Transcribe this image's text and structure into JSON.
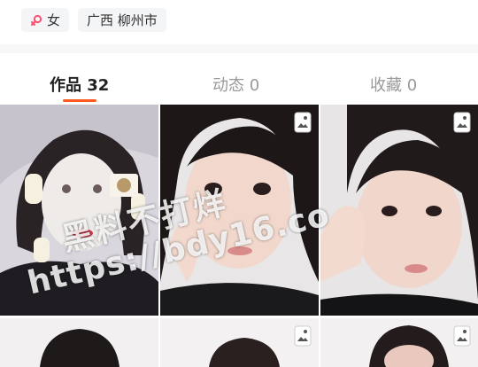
{
  "profile": {
    "gender_label": "女",
    "location_label": "广西 柳州市"
  },
  "tabs": [
    {
      "label": "作品 32",
      "active": true
    },
    {
      "label": "动态 0",
      "active": false
    },
    {
      "label": "收藏 0",
      "active": false
    }
  ],
  "accent_color": "#ff5a1f",
  "grid": {
    "items": [
      {
        "icon": "photo"
      },
      {
        "icon": "album-icon"
      },
      {
        "icon": "album-icon"
      },
      {
        "icon": "photo"
      },
      {
        "icon": "album-icon"
      },
      {
        "icon": "album-icon"
      }
    ]
  },
  "watermark": {
    "line1": "黑料不打烊",
    "line2": "https://bdy16.co"
  }
}
